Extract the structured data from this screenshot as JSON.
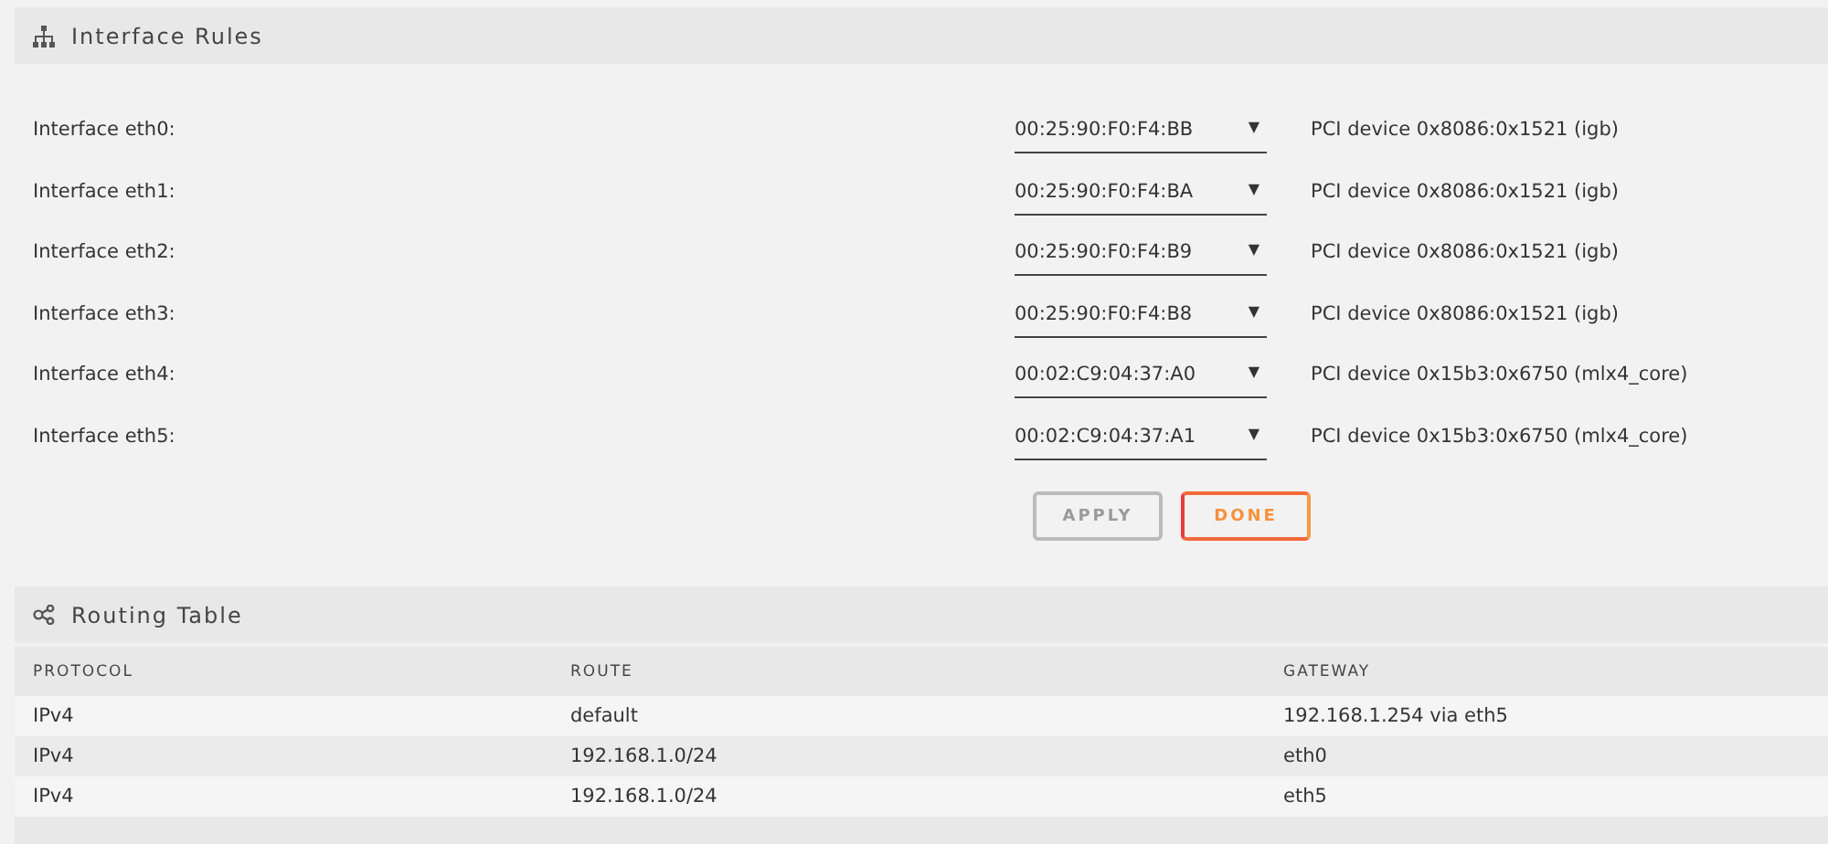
{
  "interface_rules": {
    "title": "Interface Rules",
    "rows": [
      {
        "label": "Interface eth0:",
        "mac": "00:25:90:F0:F4:BB",
        "caret": "▼",
        "device": "PCI device 0x8086:0x1521 (igb)"
      },
      {
        "label": "Interface eth1:",
        "mac": "00:25:90:F0:F4:BA",
        "caret": "▼",
        "device": "PCI device 0x8086:0x1521 (igb)"
      },
      {
        "label": "Interface eth2:",
        "mac": "00:25:90:F0:F4:B9",
        "caret": "▼",
        "device": "PCI device 0x8086:0x1521 (igb)"
      },
      {
        "label": "Interface eth3:",
        "mac": "00:25:90:F0:F4:B8",
        "caret": "▼",
        "device": "PCI device 0x8086:0x1521 (igb)"
      },
      {
        "label": "Interface eth4:",
        "mac": "00:02:C9:04:37:A0",
        "caret": "▼",
        "device": "PCI device 0x15b3:0x6750 (mlx4_core)"
      },
      {
        "label": "Interface eth5:",
        "mac": "00:02:C9:04:37:A1",
        "caret": "▼",
        "device": "PCI device 0x15b3:0x6750 (mlx4_core)"
      }
    ],
    "buttons": [
      {
        "label": "APPLY",
        "disabled": true
      },
      {
        "label": "DONE",
        "disabled": false
      }
    ]
  },
  "routing_table": {
    "title": "Routing Table",
    "columns": [
      "PROTOCOL",
      "ROUTE",
      "GATEWAY"
    ],
    "rows": [
      [
        "IPv4",
        "default",
        "192.168.1.254 via eth5"
      ],
      [
        "IPv4",
        "192.168.1.0/24",
        "eth0"
      ],
      [
        "IPv4",
        "192.168.1.0/24",
        "eth5"
      ]
    ]
  }
}
